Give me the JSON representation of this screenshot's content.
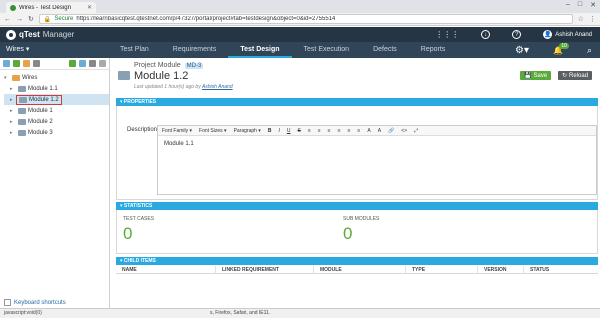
{
  "browser": {
    "tab_title": "Wires - Test Design",
    "secure_label": "Secure",
    "url": "https://learnbasicqtest.qtestnet.com/p/47327/portal/project#tab=testdesign&object=0&id=2755514"
  },
  "app": {
    "logo": "qTest",
    "product": "Manager",
    "user_name": "Ashish Anand",
    "notification_count": "10"
  },
  "nav": {
    "project": "Wires",
    "tabs": [
      "Test Plan",
      "Requirements",
      "Test Design",
      "Test Execution",
      "Defects",
      "Reports"
    ],
    "active_tab": "Test Design"
  },
  "tree": {
    "root": "Wires",
    "items": [
      "Module 1.1",
      "Module 1.2",
      "Module 1",
      "Module 2",
      "Module 3"
    ],
    "selected": "Module 1.2"
  },
  "left_footer": "Keyboard shortcuts",
  "detail": {
    "breadcrumb": "Project Module",
    "badge": "MD-3",
    "title": "Module 1.2",
    "updated_text": "Last updated 1 hour(s) ago by",
    "updated_by": "Ashish Anand",
    "save_label": "Save",
    "reload_label": "Reload"
  },
  "properties": {
    "header": "PROPERTIES",
    "description_label": "Description",
    "toolbar": [
      "Font Family",
      "Font Sizes",
      "Paragraph",
      "B",
      "I",
      "U",
      "S",
      "≡",
      "≡",
      "≡",
      "≡",
      "≡",
      "≡",
      "A",
      "A",
      "🔗",
      "<>",
      "⤢"
    ],
    "description_value": "Module 1.1"
  },
  "statistics": {
    "header": "STATISTICS",
    "test_cases_label": "TEST CASES",
    "test_cases_value": "0",
    "sub_modules_label": "SUB MODULES",
    "sub_modules_value": "0"
  },
  "child_items": {
    "header": "CHILD ITEMS",
    "columns": [
      "NAME",
      "LINKED REQUIREMENT",
      "MODULE",
      "TYPE",
      "VERSION",
      "STATUS"
    ]
  },
  "statusbar": {
    "left": "javascript:void(0)",
    "middle": "s, Firefox, Safari, and IE11."
  }
}
